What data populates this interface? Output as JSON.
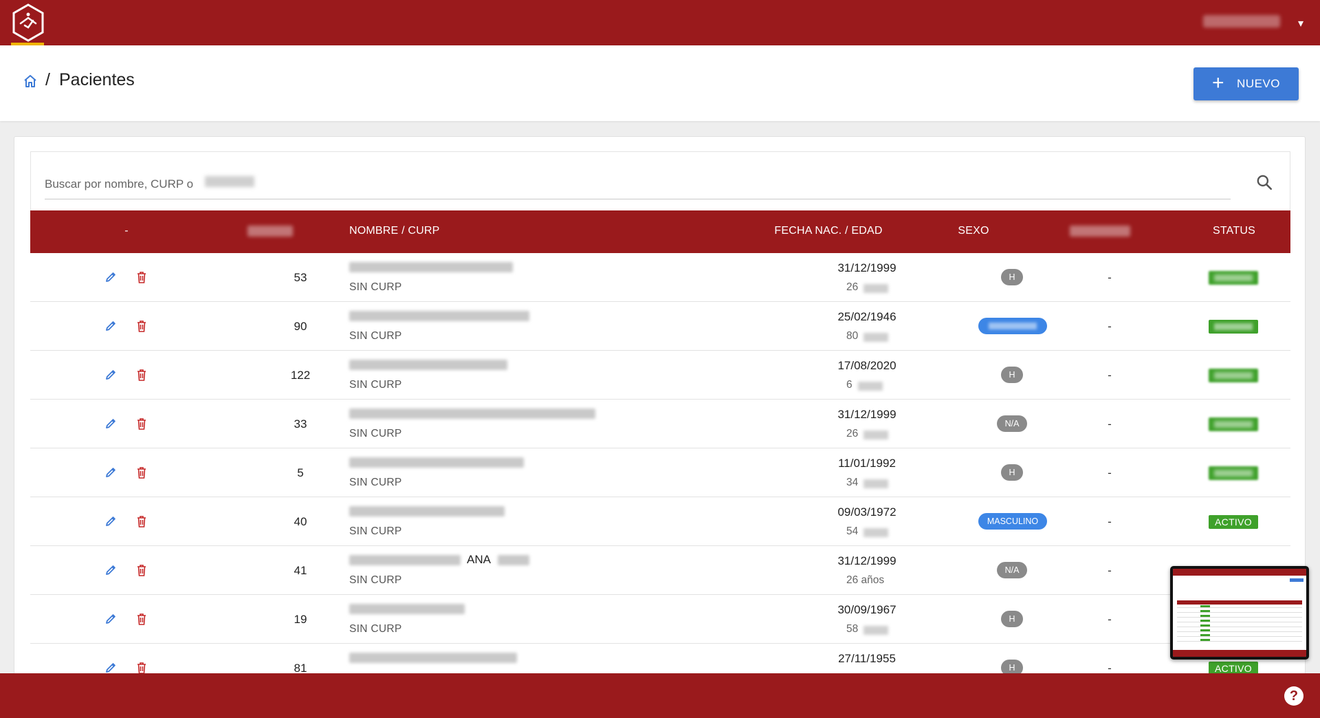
{
  "breadcrumb": {
    "separator": "/",
    "title": "Pacientes"
  },
  "header": {
    "new_button_label": "NUEVO",
    "new_button_icon": "plus-icon"
  },
  "search": {
    "placeholder": "Buscar por nombre, CURP o"
  },
  "table": {
    "columns": {
      "actions": "-",
      "name_curp": "NOMBRE / CURP",
      "dob_age": "FECHA NAC. / EDAD",
      "sex": "SEXO",
      "status": "STATUS"
    },
    "rows": [
      {
        "code": "53",
        "curp": "SIN CURP",
        "dob": "31/12/1999",
        "age": "26",
        "sex": "H",
        "sex_style": "grey",
        "phone": "-"
      },
      {
        "code": "90",
        "curp": "SIN CURP",
        "dob": "25/02/1946",
        "age": "80",
        "sex": "",
        "sex_style": "blue",
        "phone": "-",
        "status": ""
      },
      {
        "code": "122",
        "curp": "SIN CURP",
        "dob": "17/08/2020",
        "age": "6",
        "sex": "H",
        "sex_style": "grey",
        "phone": "-"
      },
      {
        "code": "33",
        "curp": "SIN CURP",
        "dob": "31/12/1999",
        "age": "26",
        "sex": "N/A",
        "sex_style": "grey",
        "phone": "-"
      },
      {
        "code": "5",
        "curp": "SIN CURP",
        "dob": "11/01/1992",
        "age": "34",
        "sex": "H",
        "sex_style": "grey",
        "phone": "-"
      },
      {
        "code": "40",
        "curp": "SIN CURP",
        "dob": "09/03/1972",
        "age": "54",
        "sex": "MASCULINO",
        "sex_style": "blue",
        "phone": "-",
        "status": "ACTIVO"
      },
      {
        "code": "41",
        "name_visible": "ANA",
        "curp": "SIN CURP",
        "dob": "31/12/1999",
        "age": "26 años",
        "sex": "N/A",
        "sex_style": "grey",
        "phone": "-"
      },
      {
        "code": "19",
        "curp": "SIN CURP",
        "dob": "30/09/1967",
        "age": "58",
        "sex": "H",
        "sex_style": "grey",
        "phone": "-"
      },
      {
        "code": "81",
        "curp": "",
        "dob": "27/11/1955",
        "age": "",
        "sex": "H",
        "sex_style": "grey",
        "phone": "-",
        "status": "ACTIVO"
      }
    ]
  },
  "help": {
    "label": "?"
  },
  "colors": {
    "brand_red": "#9a1a1c",
    "accent_blue": "#3d7ad6",
    "status_green": "#3fa12b",
    "badge_grey": "#8a8a8a"
  }
}
